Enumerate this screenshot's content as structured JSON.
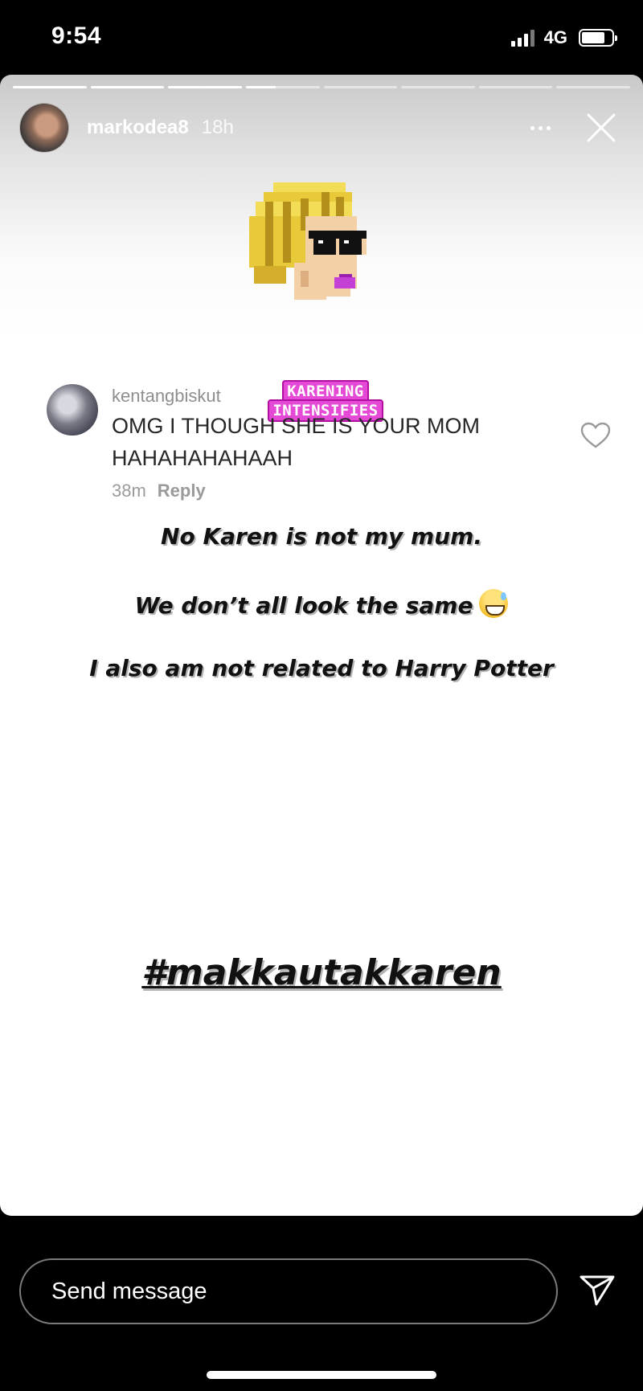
{
  "status_bar": {
    "time": "9:54",
    "network": "4G",
    "battery_level": 0.78
  },
  "story": {
    "progress": {
      "segments_total": 8,
      "segments_complete": 3,
      "current_segment_fraction": 0.4
    },
    "username": "markodea8",
    "time_ago": "18h",
    "sticker": {
      "line1": "KARENING",
      "line2": "INTENSIFIES"
    },
    "comment": {
      "username": "kentangbiskut",
      "text": "OMG I THOUGH SHE IS YOUR MOM HAHAHAHAHAAH",
      "time": "38m",
      "reply_label": "Reply"
    },
    "overlay_lines": {
      "line1": "No Karen is not my mum.",
      "line2": "We don’t all look the same",
      "line3": "I also am not related to Harry Potter"
    },
    "hashtag": "#makkautakkaren"
  },
  "footer": {
    "message_placeholder": "Send message"
  },
  "icons": {
    "more": "more-horizontal-icon",
    "close": "close-icon",
    "like": "heart-outline-icon",
    "send": "send-paper-plane-icon",
    "emoji": "grinning-sweat-emoji"
  },
  "colors": {
    "background": "#000000",
    "comment_text": "#262626",
    "muted_text": "#8e8e8e",
    "sticker_magenta": "#e54ad6"
  }
}
